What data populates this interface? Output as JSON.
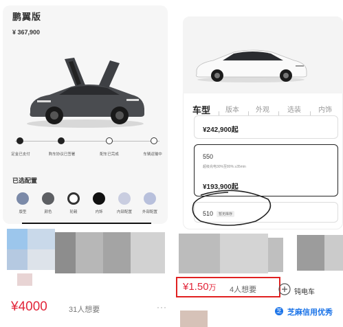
{
  "left_card": {
    "model_name": "鹏翼版",
    "price": "¥ 367,900",
    "steps": [
      {
        "label": "定金已支付",
        "done": true
      },
      {
        "label": "购车协议已签署",
        "done": true
      },
      {
        "label": "配车已完成",
        "done": false
      },
      {
        "label": "车辆运输中",
        "done": false
      }
    ],
    "selected_title": "已选配置",
    "configs": [
      "版型",
      "颜色",
      "轮毂",
      "内饰",
      "内部配置",
      "外部配置"
    ]
  },
  "right_card": {
    "tabs": [
      "车型",
      "版本",
      "外观",
      "选装",
      "内饰"
    ],
    "active_tab": "车型",
    "options": [
      {
        "price": "¥242,900起"
      },
      {
        "name": "550",
        "desc": "超级充电30%至80% ≥35min",
        "price": "¥193,900起"
      },
      {
        "name": "510",
        "badge": "暂无库存"
      }
    ]
  },
  "listings": {
    "left_price": "¥4000",
    "left_wants": "31人想要",
    "more": "···",
    "right_price_prefix": "¥1.50",
    "right_price_unit": "万",
    "right_wants": "4人想要",
    "zhima_label": "芝麻信用优秀",
    "watermark": "钝电车"
  },
  "colors": {
    "price_red": "#e2263a",
    "box_red": "#e02020",
    "zhima_blue": "#1a73e8"
  }
}
